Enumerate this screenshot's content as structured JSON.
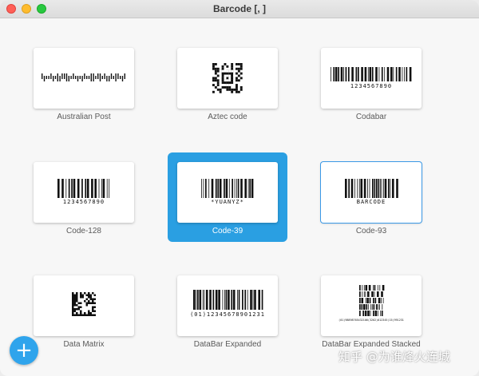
{
  "window": {
    "title": "Barcode [, ]"
  },
  "barcodes": [
    {
      "label": "Australian Post",
      "type": "australian-post",
      "text": ""
    },
    {
      "label": "Aztec code",
      "type": "aztec",
      "text": ""
    },
    {
      "label": "Codabar",
      "type": "linear",
      "text": "1234567890"
    },
    {
      "label": "Code-128",
      "type": "linear",
      "text": "1234567890"
    },
    {
      "label": "Code-39",
      "type": "linear",
      "text": "*YUANYZ*"
    },
    {
      "label": "Code-93",
      "type": "linear",
      "text": "BARCODE"
    },
    {
      "label": "Data Matrix",
      "type": "datamatrix",
      "text": ""
    },
    {
      "label": "DataBar Expanded",
      "type": "linear",
      "text": "(01)12345678901231"
    },
    {
      "label": "DataBar Expanded Stacked",
      "type": "stacked",
      "text": "(01)98898765432106(3202)012345(15)991231"
    }
  ],
  "selected_index": 4,
  "focused_index": 5,
  "fab": {
    "symbol": "+",
    "icon": "plus-icon"
  },
  "watermark": "知乎 @为谁烽火连城",
  "colors": {
    "accent": "#2a9fe2",
    "fab": "#2fa4ec"
  }
}
